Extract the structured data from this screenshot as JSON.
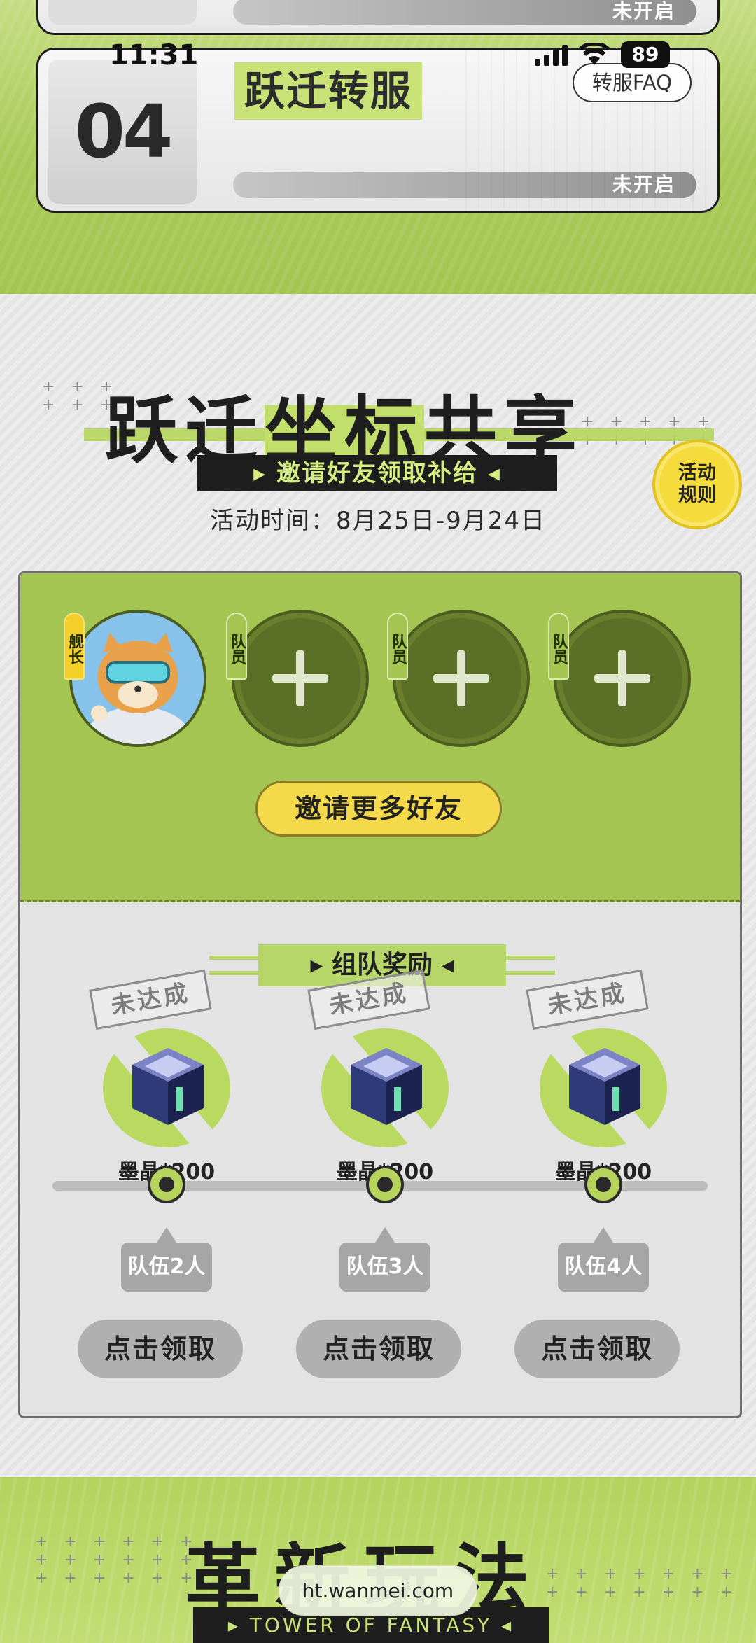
{
  "status_bar": {
    "time": "11:31",
    "battery": "89"
  },
  "steps": {
    "prev_status": "未开启",
    "step04": {
      "number": "04",
      "title": "跃迁转服",
      "status": "未开启"
    },
    "faq_label": "转服FAQ"
  },
  "event": {
    "title_parts": [
      "跃迁",
      "坐标",
      "共享"
    ],
    "subtitle": "邀请好友领取补给",
    "time": "活动时间：8月25日-9月24日",
    "rules_label": [
      "活动",
      "规则"
    ]
  },
  "team": {
    "captain_tag": "舰长",
    "member_tag": "队员",
    "invite_button": "邀请更多好友"
  },
  "rewards": {
    "title": "组队奖励",
    "items": [
      {
        "stamp": "未达成",
        "label": "墨晶*200",
        "requirement": "队伍2人",
        "button": "点击领取"
      },
      {
        "stamp": "未达成",
        "label": "墨晶*200",
        "requirement": "队伍3人",
        "button": "点击领取"
      },
      {
        "stamp": "未达成",
        "label": "墨晶*200",
        "requirement": "队伍4人",
        "button": "点击领取"
      }
    ]
  },
  "next_section": {
    "title": "革新玩法",
    "tagline": "TOWER OF FANTASY"
  },
  "browser": {
    "url": "ht.wanmei.com"
  },
  "colors": {
    "accent_green": "#a4c552",
    "dark_green": "#5c6f26",
    "yellow": "#f4d94b"
  }
}
